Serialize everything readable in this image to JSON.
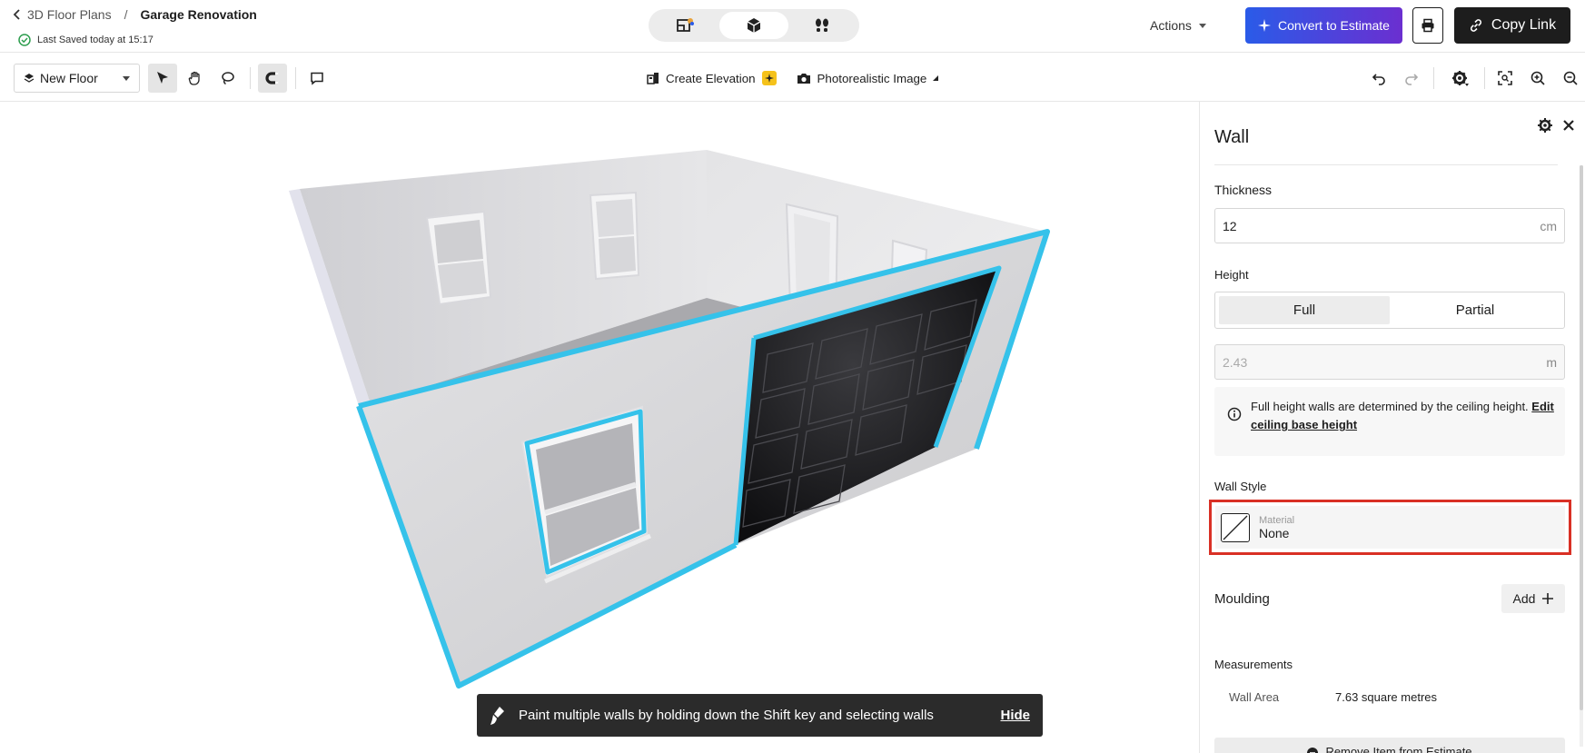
{
  "header": {
    "breadcrumb_parent": "3D Floor Plans",
    "breadcrumb_separator": "/",
    "breadcrumb_current": "Garage Renovation",
    "saved_status": "Last Saved today at 15:17",
    "actions_label": "Actions",
    "convert_label": "Convert to Estimate",
    "copy_link_label": "Copy Link",
    "view_modes": [
      "2d-plan-icon",
      "3d-box-icon",
      "walkthrough-icon"
    ],
    "active_view_mode": 1
  },
  "toolbar": {
    "floor_select_label": "New Floor",
    "create_elevation_label": "Create Elevation",
    "photorealistic_label": "Photorealistic Image"
  },
  "toast": {
    "message": "Paint multiple walls by holding down the Shift key and selecting walls",
    "hide_label": "Hide"
  },
  "panel": {
    "title": "Wall",
    "thickness_label": "Thickness",
    "thickness_value": "12",
    "thickness_unit": "cm",
    "height_label": "Height",
    "height_options": [
      "Full",
      "Partial"
    ],
    "height_selected": "Full",
    "height_value": "2.43",
    "height_unit": "m",
    "info_text": "Full height walls are determined by the ceiling height.",
    "info_link": "Edit ceiling base height",
    "wall_style_label": "Wall Style",
    "material_caption": "Material",
    "material_value": "None",
    "moulding_label": "Moulding",
    "add_label": "Add",
    "measurements_label": "Measurements",
    "wall_area_label": "Wall Area",
    "wall_area_value": "7.63 square metres",
    "remove_label": "Remove Item from Estimate"
  },
  "colors": {
    "selection_outline": "#35c2ea",
    "highlight_box": "#d93025",
    "convert_gradient_start": "#2a5be8",
    "convert_gradient_end": "#6b2fd0",
    "saved_check": "#2e9e4f",
    "elevation_badge": "#f5c21b"
  }
}
